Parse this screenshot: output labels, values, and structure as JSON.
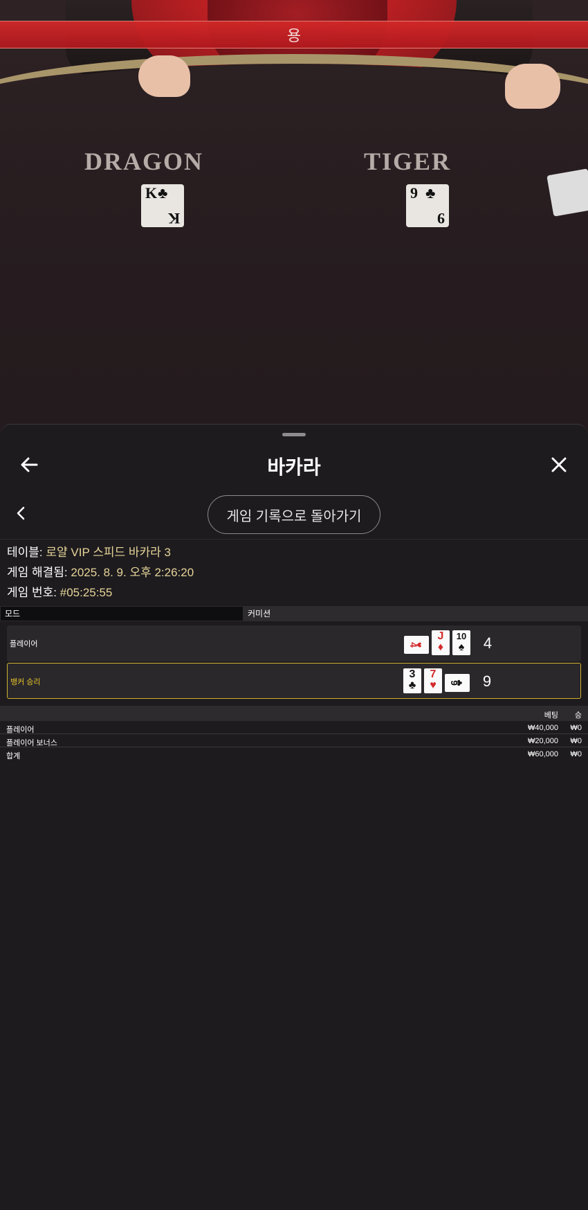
{
  "video": {
    "banner_text": "용",
    "left_label": "DRAGON",
    "right_label": "TIGER",
    "dragon_card": {
      "rank": "K",
      "suit": "♣"
    },
    "tiger_card": {
      "rank": "9",
      "suit": "♣"
    }
  },
  "header": {
    "title": "바카라"
  },
  "nav": {
    "history_button": "게임 기록으로 돌아가기"
  },
  "info": {
    "table_key": "테이블:",
    "table_val": " 로얄 VIP 스피드 바카라 3",
    "resolved_key": "게임 해결됨:",
    "resolved_val": " 2025. 8. 9. 오후 2:26:20",
    "number_key": "게임 번호:",
    "number_val": " #05:25:55"
  },
  "mode": {
    "label": "모드",
    "value": "커미션"
  },
  "results": [
    {
      "label": "플레이어",
      "winner": false,
      "cards": [
        {
          "rank": "4",
          "suit": "♥",
          "color": "red",
          "sideways": true
        },
        {
          "rank": "J",
          "suit": "♦",
          "color": "red",
          "sideways": false
        },
        {
          "rank": "10",
          "suit": "♠",
          "color": "black",
          "sideways": false
        }
      ],
      "score": "4"
    },
    {
      "label": "뱅커 승리",
      "winner": true,
      "cards": [
        {
          "rank": "3",
          "suit": "♣",
          "color": "black",
          "sideways": false
        },
        {
          "rank": "7",
          "suit": "♥",
          "color": "red",
          "sideways": false
        },
        {
          "rank": "9",
          "suit": "♣",
          "color": "black",
          "sideways": true
        }
      ],
      "score": "9"
    }
  ],
  "bets": {
    "head_bet": "베팅",
    "head_win": "승",
    "rows": [
      {
        "name": "플레이어",
        "bet": "₩40,000",
        "win": "₩0"
      },
      {
        "name": "플레이어 보너스",
        "bet": "₩20,000",
        "win": "₩0"
      },
      {
        "name": "합계",
        "bet": "₩60,000",
        "win": "₩0"
      }
    ]
  },
  "colors": {
    "accent_gold": "#e6c52a",
    "info_value": "#e7d59a",
    "sheet_bg": "#1d1b1e"
  }
}
